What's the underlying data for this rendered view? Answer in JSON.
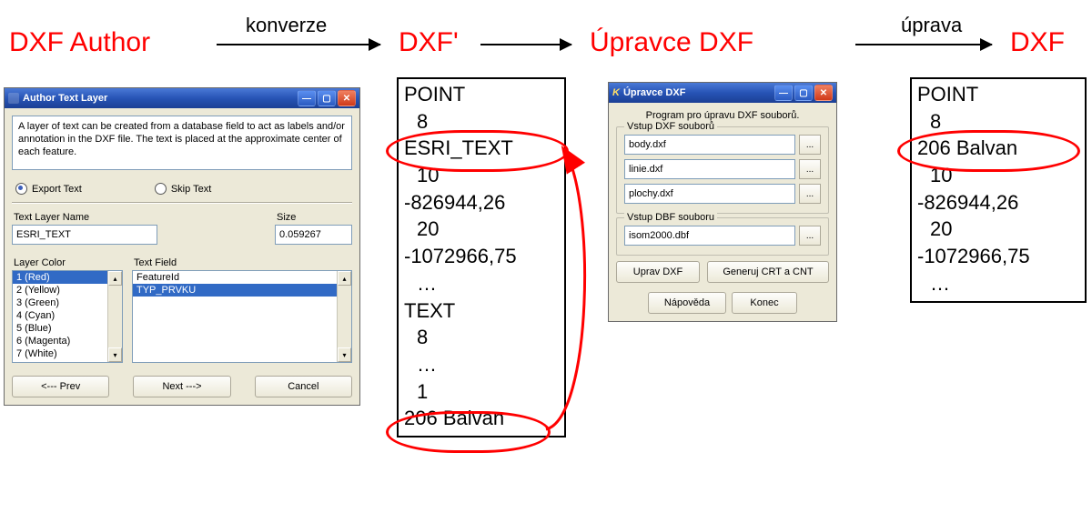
{
  "flow": {
    "node1": "DXF Author",
    "arrow1_label": "konverze",
    "node2": "DXF'",
    "node3": "Úpravce DXF",
    "arrow3_label": "úprava",
    "node4": "DXF"
  },
  "author_dialog": {
    "title": "Author Text Layer",
    "description": "A layer of text can be created from a database field to act as labels and/or annotation in the DXF file.  The text is placed at the approximate center of each feature.",
    "radio_export": "Export Text",
    "radio_skip": "Skip Text",
    "text_layer_name_label": "Text Layer Name",
    "text_layer_name_value": "ESRI_TEXT",
    "size_label": "Size",
    "size_value": "0.059267",
    "layer_color_label": "Layer Color",
    "text_field_label": "Text Field",
    "layer_colors": [
      "1 (Red)",
      "2 (Yellow)",
      "3 (Green)",
      "4 (Cyan)",
      "5 (Blue)",
      "6 (Magenta)",
      "7 (White)"
    ],
    "text_fields": [
      "FeatureId",
      "TYP_PRVKU"
    ],
    "btn_prev": "<--- Prev",
    "btn_next": "Next --->",
    "btn_cancel": "Cancel"
  },
  "dxfprime": {
    "l1": "POINT",
    "l2": "8",
    "l3": "ESRI_TEXT",
    "l4": "10",
    "l5": "-826944,26",
    "l6": "20",
    "l7": "-1072966,75",
    "dots1": "…",
    "l8": "TEXT",
    "l9": "8",
    "dots2": "…",
    "l10": "1",
    "l11": "206 Balvan"
  },
  "upravce_dialog": {
    "title": "Úpravce DXF",
    "subtitle": "Program pro úpravu DXF souborů.",
    "group_dxf": "Vstup DXF souborů",
    "dxf_files": [
      "body.dxf",
      "linie.dxf",
      "plochy.dxf"
    ],
    "group_dbf": "Vstup DBF souboru",
    "dbf_file": "isom2000.dbf",
    "btn_uprav": "Uprav DXF",
    "btn_generuj": "Generuj CRT a CNT",
    "btn_help": "Nápověda",
    "btn_close": "Konec",
    "browse": "..."
  },
  "dxf_out": {
    "l1": "POINT",
    "l2": "8",
    "l3": "206 Balvan",
    "l4": "10",
    "l5": "-826944,26",
    "l6": "20",
    "l7": "-1072966,75",
    "dots": "…"
  }
}
